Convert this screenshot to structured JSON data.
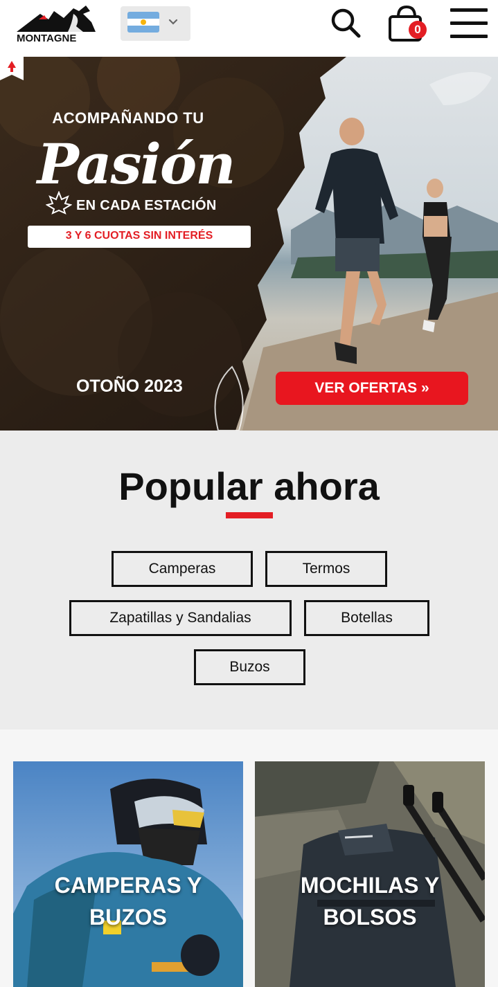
{
  "header": {
    "logo_text": "MONTAGNE",
    "country_flag_name": "argentina-flag",
    "cart_count": "0",
    "icons": [
      "search-icon",
      "cart-icon",
      "hamburger-menu-icon",
      "chevron-down-icon"
    ]
  },
  "hero": {
    "kicker": "ACOMPAÑANDO TU",
    "title": "Pasión",
    "subtitle": "EN CADA ESTACIÓN",
    "promo": "3 Y 6 CUOTAS SIN INTERÉS",
    "season": "OTOÑO 2023",
    "cta": "VER OFERTAS »"
  },
  "popular": {
    "title": "Popular ahora",
    "chips": [
      "Camperas",
      "Termos",
      "Zapatillas y Sandalias",
      "Botellas",
      "Buzos"
    ]
  },
  "categories": [
    {
      "line1": "CAMPERAS Y",
      "line2": "BUZOS"
    },
    {
      "line1": "MOCHILAS Y",
      "line2": "BOLSOS"
    }
  ],
  "colors": {
    "accent_red": "#e31e24",
    "section_gray": "#ececec",
    "text_dark": "#111111"
  }
}
